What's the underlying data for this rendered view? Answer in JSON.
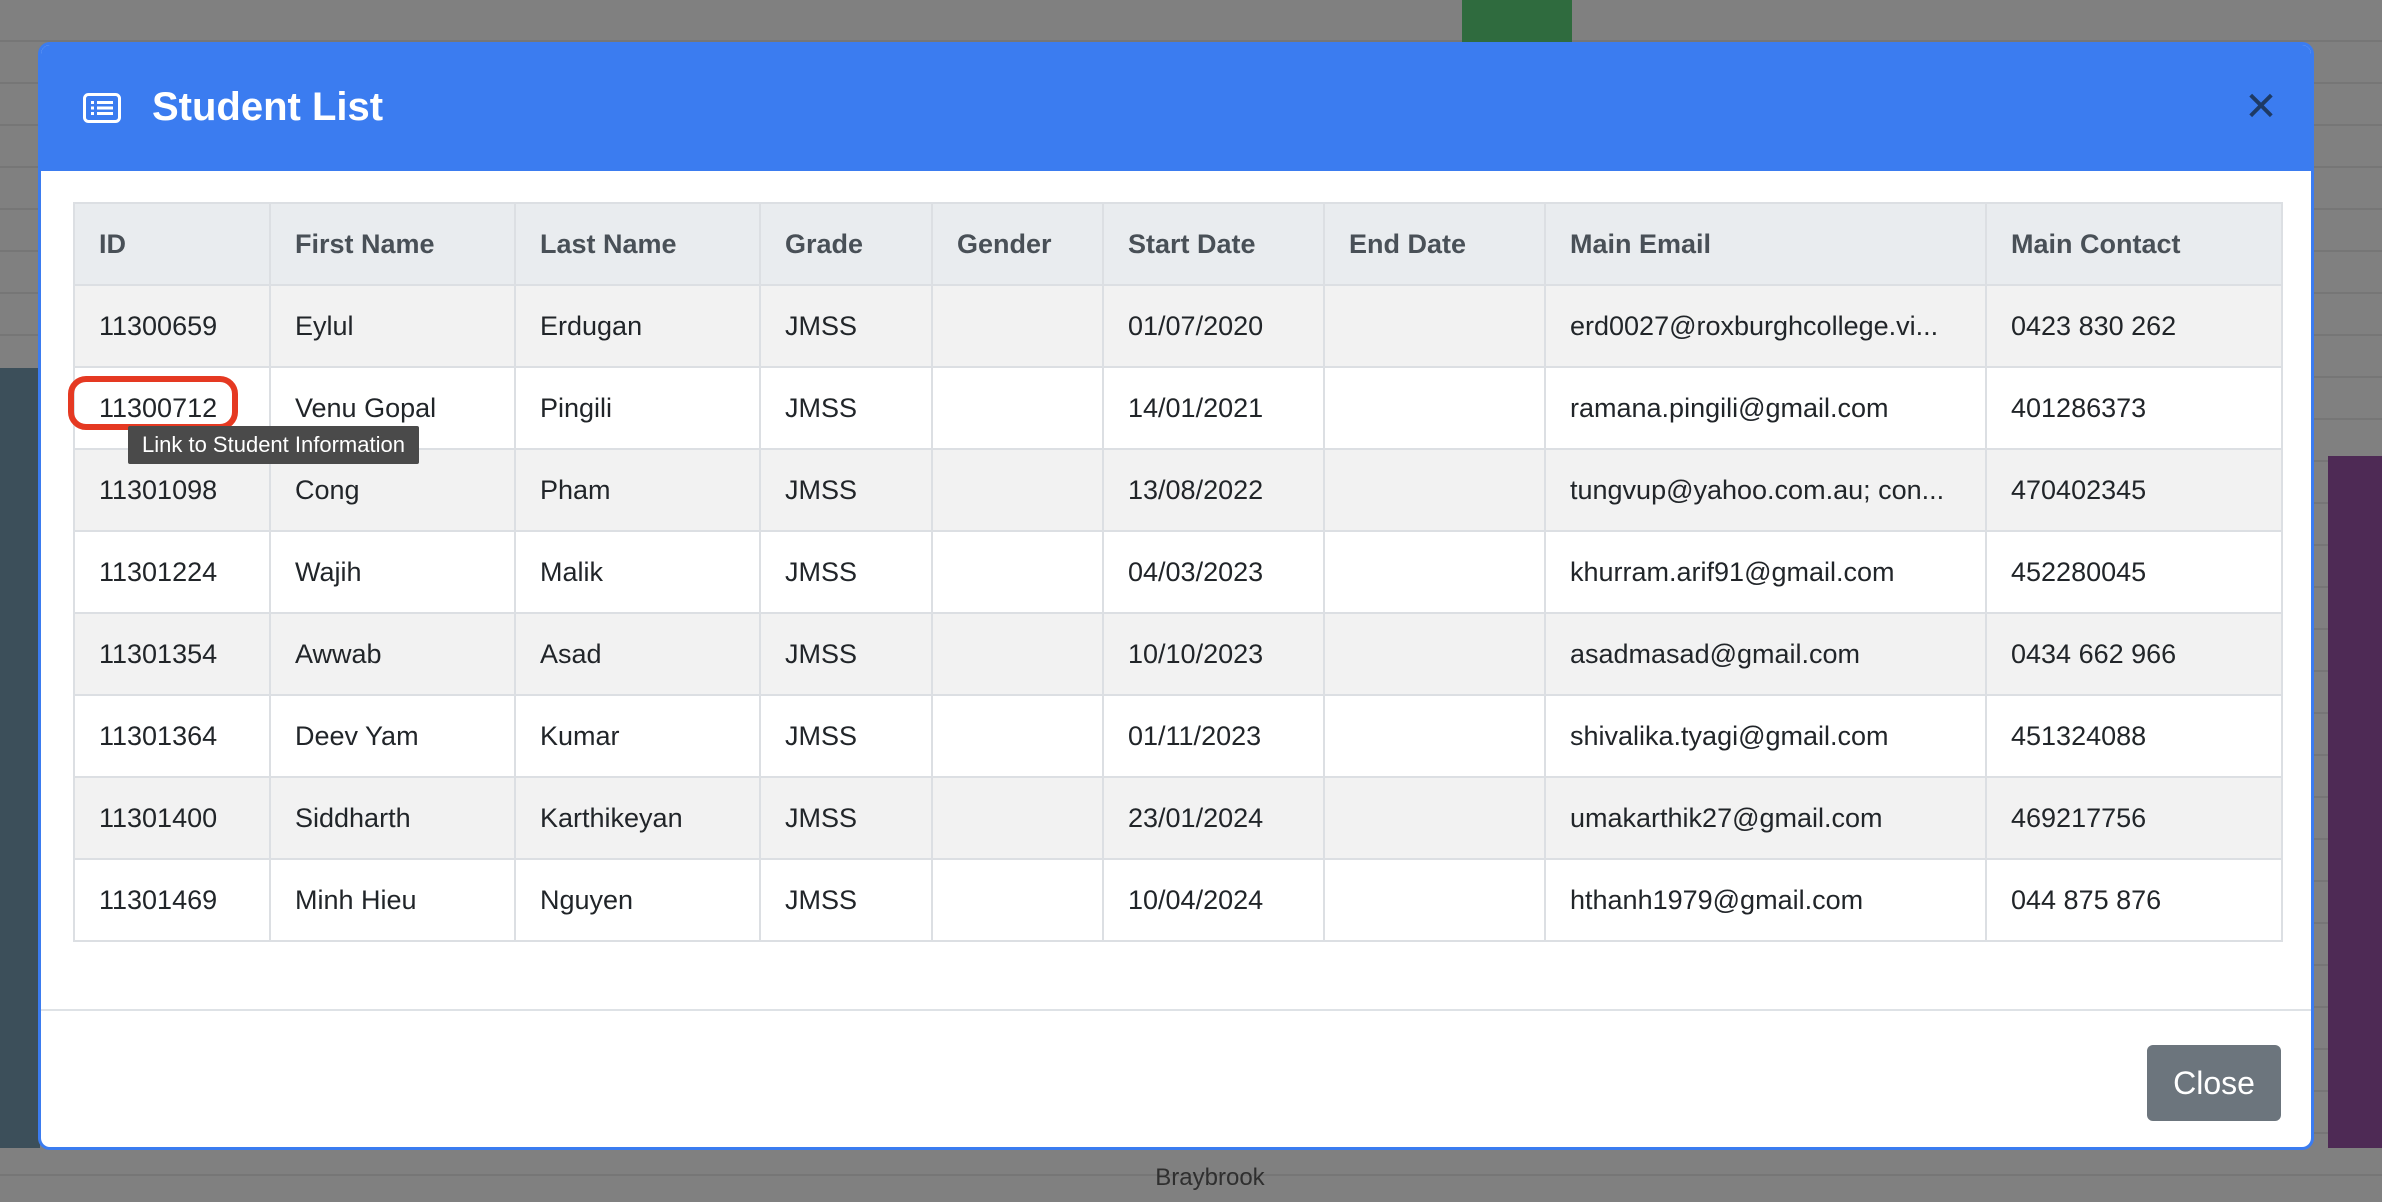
{
  "background": {
    "footer_text": "Braybrook"
  },
  "modal": {
    "title": "Student List",
    "header_icon": "list-icon",
    "close_symbol": "✕",
    "close_button_label": "Close",
    "accent_color": "#3b7cf0"
  },
  "table": {
    "columns": [
      "ID",
      "First Name",
      "Last Name",
      "Grade",
      "Gender",
      "Start Date",
      "End Date",
      "Main Email",
      "Main Contact"
    ],
    "rows": [
      {
        "id": "11300659",
        "first_name": "Eylul",
        "last_name": "Erdugan",
        "grade": "JMSS",
        "gender": "",
        "start_date": "01/07/2020",
        "end_date": "",
        "main_email": "erd0027@roxburghcollege.vi...",
        "main_contact": "0423 830 262"
      },
      {
        "id": "11300712",
        "first_name": "Venu Gopal",
        "last_name": "Pingili",
        "grade": "JMSS",
        "gender": "",
        "start_date": "14/01/2021",
        "end_date": "",
        "main_email": "ramana.pingili@gmail.com",
        "main_contact": "401286373"
      },
      {
        "id": "11301098",
        "first_name": "Cong",
        "last_name": "Pham",
        "grade": "JMSS",
        "gender": "",
        "start_date": "13/08/2022",
        "end_date": "",
        "main_email": "tungvup@yahoo.com.au; con...",
        "main_contact": "470402345"
      },
      {
        "id": "11301224",
        "first_name": "Wajih",
        "last_name": "Malik",
        "grade": "JMSS",
        "gender": "",
        "start_date": "04/03/2023",
        "end_date": "",
        "main_email": "khurram.arif91@gmail.com",
        "main_contact": "452280045"
      },
      {
        "id": "11301354",
        "first_name": "Awwab",
        "last_name": "Asad",
        "grade": "JMSS",
        "gender": "",
        "start_date": "10/10/2023",
        "end_date": "",
        "main_email": "asadmasad@gmail.com",
        "main_contact": "0434 662 966"
      },
      {
        "id": "11301364",
        "first_name": "Deev Yam",
        "last_name": "Kumar",
        "grade": "JMSS",
        "gender": "",
        "start_date": "01/11/2023",
        "end_date": "",
        "main_email": "shivalika.tyagi@gmail.com",
        "main_contact": "451324088"
      },
      {
        "id": "11301400",
        "first_name": "Siddharth",
        "last_name": "Karthikeyan",
        "grade": "JMSS",
        "gender": "",
        "start_date": "23/01/2024",
        "end_date": "",
        "main_email": "umakarthik27@gmail.com",
        "main_contact": "469217756"
      },
      {
        "id": "11301469",
        "first_name": "Minh Hieu",
        "last_name": "Nguyen",
        "grade": "JMSS",
        "gender": "",
        "start_date": "10/04/2024",
        "end_date": "",
        "main_email": "hthanh1979@gmail.com",
        "main_contact": "044 875 876"
      }
    ]
  },
  "tooltip": {
    "text": "Link to Student Information",
    "highlight_color": "#e53922"
  }
}
